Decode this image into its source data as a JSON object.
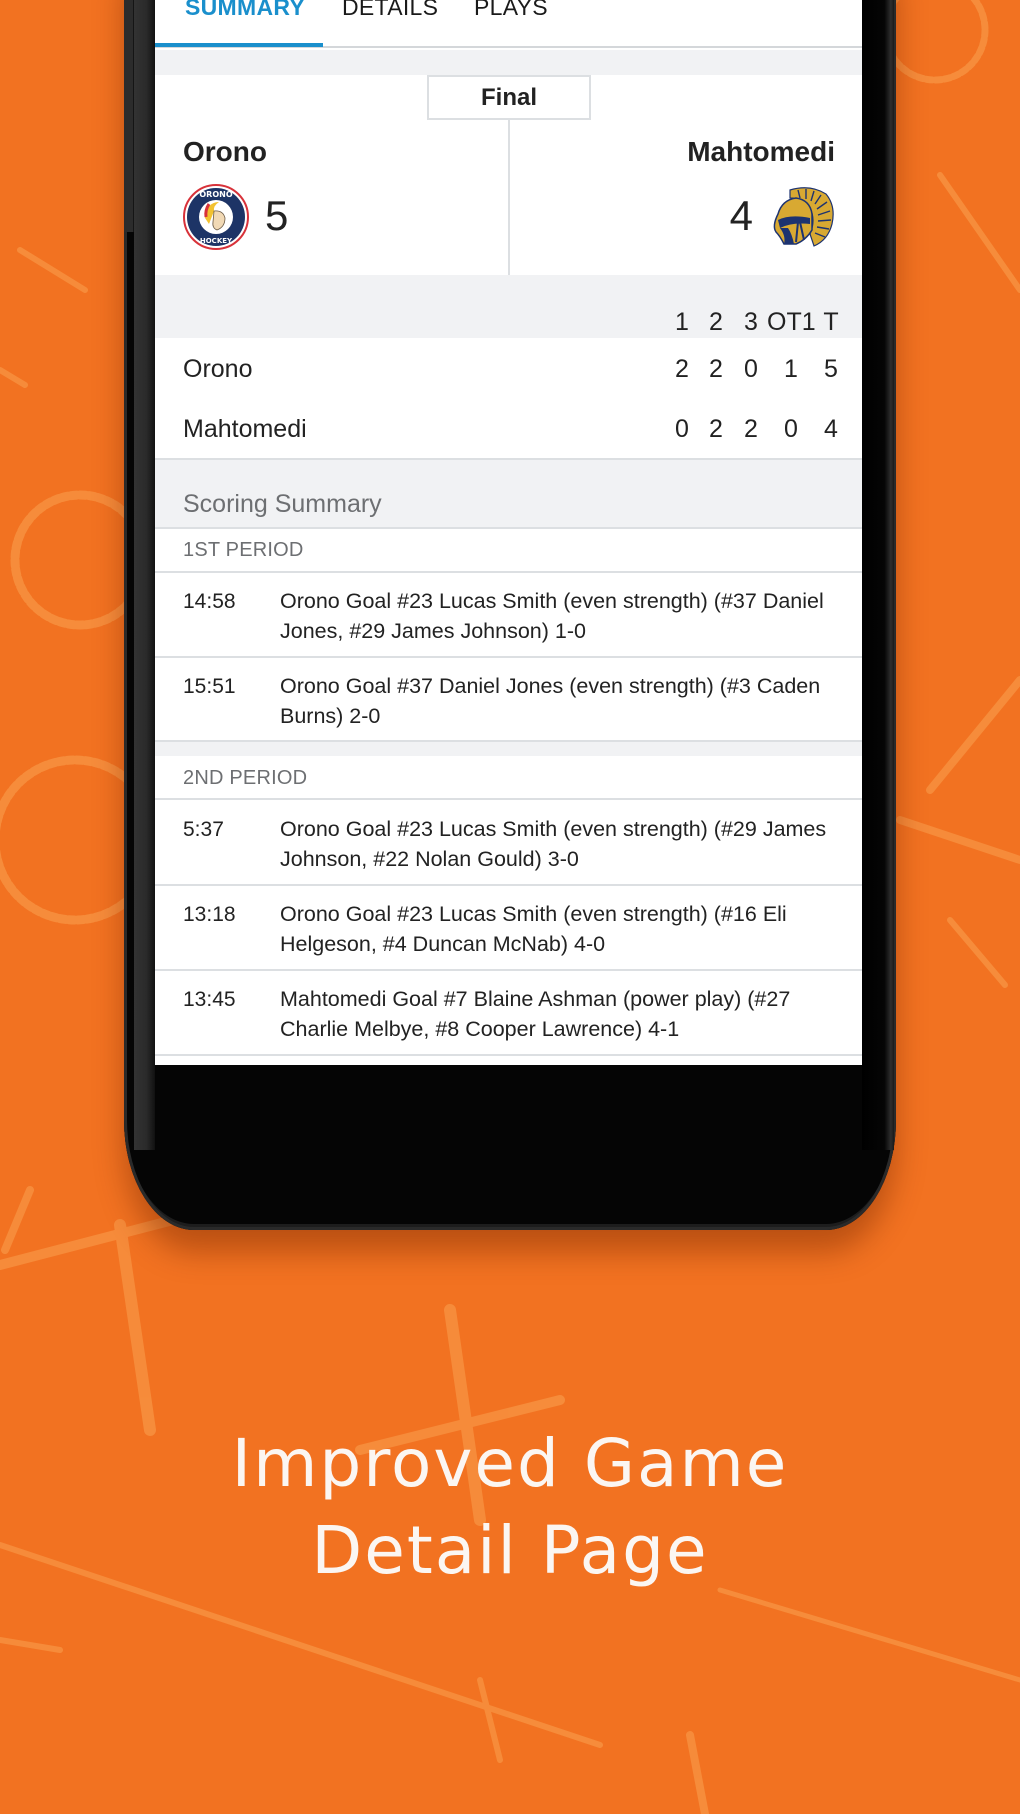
{
  "tabs": [
    {
      "label": "SUMMARY",
      "active": true
    },
    {
      "label": "DETAILS",
      "active": false
    },
    {
      "label": "PLAYS",
      "active": false
    }
  ],
  "game": {
    "status": "Final",
    "home": {
      "name": "Orono",
      "score": "5",
      "logo": "orono-hockey-logo"
    },
    "away": {
      "name": "Mahtomedi",
      "score": "4",
      "logo": "mahtomedi-spartan-logo"
    }
  },
  "line_score": {
    "headers": [
      "1",
      "2",
      "3",
      "OT1",
      "T"
    ],
    "rows": [
      {
        "team": "Orono",
        "values": [
          "2",
          "2",
          "0",
          "1",
          "5"
        ]
      },
      {
        "team": "Mahtomedi",
        "values": [
          "0",
          "2",
          "2",
          "0",
          "4"
        ]
      }
    ]
  },
  "scoring_summary": {
    "title": "Scoring Summary",
    "periods": [
      {
        "label": "1ST PERIOD",
        "goals": [
          {
            "time": "14:58",
            "description": "Orono Goal #23 Lucas Smith (even strength) (#37 Daniel Jones, #29 James Johnson) 1-0"
          },
          {
            "time": "15:51",
            "description": "Orono Goal #37 Daniel Jones (even strength) (#3 Caden Burns) 2-0"
          }
        ]
      },
      {
        "label": "2ND PERIOD",
        "goals": [
          {
            "time": "5:37",
            "description": "Orono Goal #23 Lucas Smith (even strength) (#29 James Johnson, #22 Nolan Gould) 3-0"
          },
          {
            "time": "13:18",
            "description": "Orono Goal #23 Lucas Smith (even strength) (#16 Eli Helgeson, #4 Duncan McNab) 4-0"
          },
          {
            "time": "13:45",
            "description": "Mahtomedi Goal #7 Blaine Ashman (power play) (#27 Charlie Melbye, #8 Cooper Lawrence) 4-1"
          }
        ]
      }
    ]
  },
  "promo": {
    "line1": "Improved Game",
    "line2": "Detail Page"
  },
  "colors": {
    "background": "#f27221",
    "accent": "#1a8fcc",
    "orono_navy": "#1d3466",
    "orono_red": "#d8323a",
    "mahtomedi_gold": "#d8a932",
    "mahtomedi_navy": "#1d3370"
  }
}
